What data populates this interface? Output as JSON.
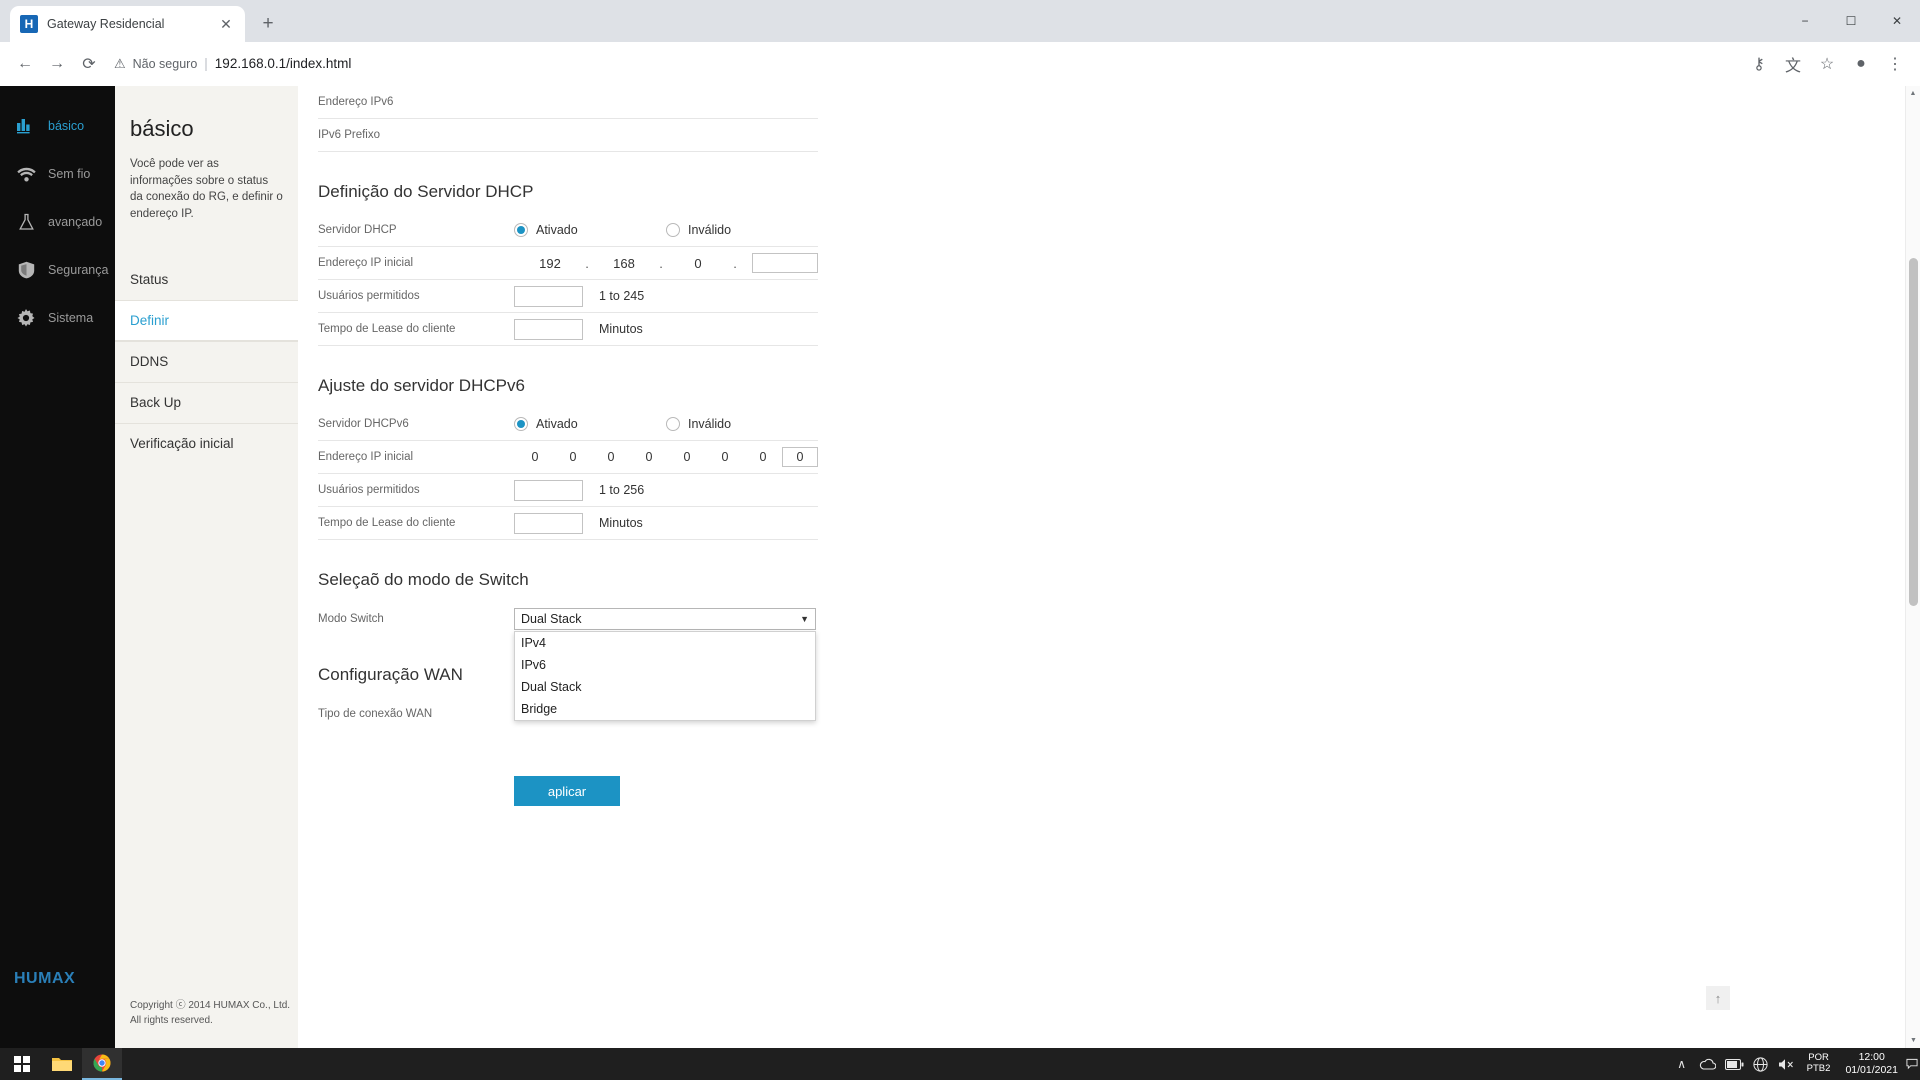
{
  "browser": {
    "tab": {
      "title": "Gateway Residencial",
      "favicon_letter": "H",
      "close_icon": "✕"
    },
    "new_tab_icon": "+",
    "window_controls": {
      "minimize": "−",
      "maximize": "☐",
      "close": "✕"
    },
    "nav": {
      "back_icon": "←",
      "forward_icon": "→",
      "reload_icon": "⟳"
    },
    "omnibox": {
      "warning_icon": "⚠",
      "security_label": "Não seguro",
      "separator": "|",
      "url": "192.168.0.1/index.html"
    },
    "toolbar_right": {
      "key_icon": "⚷",
      "translate_icon": "文",
      "star_icon": "☆",
      "profile_icon": "●",
      "menu_icon": "⋮"
    }
  },
  "leftnav": {
    "items": [
      {
        "label": "básico",
        "icon": "chart-bars-icon",
        "active": true
      },
      {
        "label": "Sem fio",
        "icon": "wifi-icon",
        "active": false
      },
      {
        "label": "avançado",
        "icon": "flask-icon",
        "active": false
      },
      {
        "label": "Segurança",
        "icon": "shield-icon",
        "active": false
      },
      {
        "label": "Sistema",
        "icon": "gear-icon",
        "active": false
      }
    ],
    "brand": "HUMAX"
  },
  "submenu": {
    "title": "básico",
    "description": "Você pode ver as informações sobre o status da conexão do RG, e definir o endereço IP.",
    "items": [
      {
        "label": "Status",
        "active": false
      },
      {
        "label": "Definir",
        "active": true
      },
      {
        "label": "DDNS",
        "active": false
      },
      {
        "label": "Back Up",
        "active": false
      },
      {
        "label": "Verificação inicial",
        "active": false
      }
    ],
    "copyright_line1": "Copyright ⓒ 2014 HUMAX Co., Ltd.",
    "copyright_line2": "All rights reserved."
  },
  "content": {
    "top_rows": [
      {
        "label": "Endereço IPv6",
        "value": ""
      },
      {
        "label": "IPv6 Prefixo",
        "value": ""
      }
    ],
    "dhcp": {
      "section_title": "Definição do Servidor DHCP",
      "server_label": "Servidor DHCP",
      "enabled_label": "Ativado",
      "disabled_label": "Inválido",
      "selected": "enabled",
      "start_ip_label": "Endereço IP inicial",
      "start_ip_octets": [
        "192",
        "168",
        "0"
      ],
      "start_ip_input": "",
      "dot": ".",
      "users_label": "Usuários permitidos",
      "users_value": "",
      "users_hint": "1 to 245",
      "lease_label": "Tempo de Lease do cliente",
      "lease_value": "",
      "lease_unit": "Minutos"
    },
    "dhcpv6": {
      "section_title": "Ajuste do servidor DHCPv6",
      "server_label": "Servidor DHCPv6",
      "enabled_label": "Ativado",
      "disabled_label": "Inválido",
      "selected": "enabled",
      "start_ip_label": "Endereço IP inicial",
      "start_ip_octets": [
        "0",
        "0",
        "0",
        "0",
        "0",
        "0",
        "0"
      ],
      "start_ip_input": "0",
      "users_label": "Usuários permitidos",
      "users_value": "",
      "users_hint": "1 to 256",
      "lease_label": "Tempo de Lease do cliente",
      "lease_value": "",
      "lease_unit": "Minutos"
    },
    "switch_mode": {
      "section_title": "Seleçaõ do modo de Switch",
      "label": "Modo Switch",
      "selected_value": "Dual Stack",
      "caret_icon": "▼",
      "options": [
        "IPv4",
        "IPv6",
        "Dual Stack",
        "Bridge"
      ]
    },
    "wan": {
      "section_title": "Configuração WAN",
      "conn_type_label": "Tipo de conexão WAN"
    },
    "apply_button": "aplicar",
    "scroll_top_icon": "↑"
  },
  "scrollbar": {
    "up_icon": "▲",
    "down_icon": "▼"
  },
  "taskbar": {
    "start_icon": "⊞",
    "apps": [
      {
        "name": "file-explorer",
        "icon": "🗀",
        "active": false
      },
      {
        "name": "chrome",
        "icon": "●",
        "active": true
      }
    ],
    "tray": {
      "chevron_icon": "∧",
      "onedrive_icon": "☁",
      "battery_icon": "▬",
      "network_icon": "⊕",
      "volume_icon": "🔊"
    },
    "language_line1": "POR",
    "language_line2": "PTB2",
    "time": "12:00",
    "date": "01/01/2021",
    "notification_icon": "□"
  }
}
